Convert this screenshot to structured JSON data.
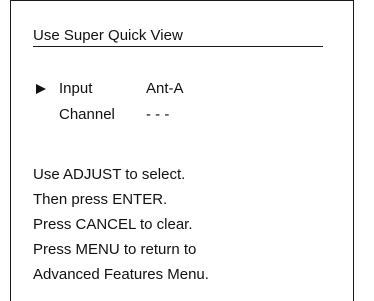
{
  "menu": {
    "title": "Use Super Quick View",
    "items": [
      {
        "label": "Input",
        "value": "Ant-A",
        "selected": true
      },
      {
        "label": "Channel",
        "value": "- - -",
        "selected": false
      }
    ],
    "cursor_icon": "triangle-right-icon"
  },
  "instructions": {
    "lines": [
      "Use ADJUST to select.",
      "Then press ENTER.",
      "Press CANCEL to clear.",
      "Press MENU to return to",
      "Advanced Features Menu."
    ]
  }
}
